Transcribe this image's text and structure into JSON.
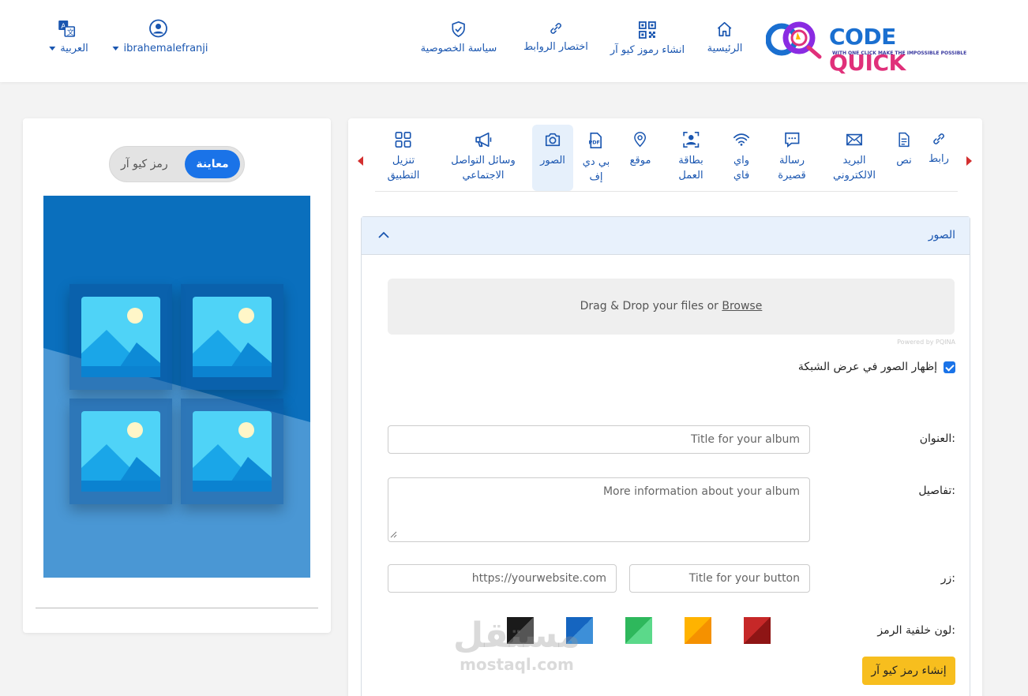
{
  "header": {
    "logo": {
      "word1": "CODE",
      "word2": "QUICK",
      "tagline": "WITH ONE CLICK MAKE THE IMPOSSIBLE POSSIBLE"
    },
    "nav": [
      {
        "label": "الرئيسية",
        "icon": "home-icon"
      },
      {
        "label": "انشاء رموز كيو آر",
        "icon": "qr-code-icon"
      },
      {
        "label": "اختصار الروابط",
        "icon": "link-icon"
      },
      {
        "label": "سياسة الخصوصية",
        "icon": "shield-check-icon"
      }
    ],
    "user": {
      "name": "ibrahemalefranji",
      "icon": "user-circle-icon"
    },
    "language": {
      "label": "العربية",
      "icon": "translate-icon"
    }
  },
  "preview": {
    "toggle_on": "معاينة",
    "toggle_off": "رمز كيو آر"
  },
  "tabs": [
    {
      "label": "رابط",
      "icon": "link-icon"
    },
    {
      "label": "نص",
      "icon": "document-text-icon"
    },
    {
      "label": "البريد\nالالكتروني",
      "icon": "envelope-icon"
    },
    {
      "label": "رسالة\nقصيرة",
      "icon": "sms-icon"
    },
    {
      "label": "واي\nفاي",
      "icon": "wifi-icon"
    },
    {
      "label": "بطاقة\nالعمل",
      "icon": "business-card-icon"
    },
    {
      "label": "موقع",
      "icon": "location-pin-icon"
    },
    {
      "label": "بي دي\nإف",
      "icon": "pdf-icon"
    },
    {
      "label": "الصور",
      "icon": "camera-icon"
    },
    {
      "label": "وسائل التواصل\nالاجتماعي",
      "icon": "megaphone-icon"
    },
    {
      "label": "تنزيل\nالتطبيق",
      "icon": "apps-grid-icon"
    }
  ],
  "form": {
    "section_title": "الصور",
    "dropzone_text": "Drag & Drop your files or ",
    "dropzone_link": "Browse",
    "powered_by": "Powered by PQINA",
    "grid_checkbox_label": "إظهار الصور في عرض الشبكة",
    "grid_checked": true,
    "title_label": "العنوان:",
    "title_placeholder": "Title for your album",
    "details_label": "تفاصيل:",
    "details_placeholder": "More information about your album",
    "button_label": "زر:",
    "button_title_placeholder": "Title for your button",
    "button_url_placeholder": "https://yourwebsite.com",
    "bg_color_label": "لون خلفية الرمز:",
    "swatches": [
      "#a51d1d",
      "#ffaa00",
      "#3cc96e",
      "#2477c4",
      "#222222"
    ],
    "submit_label": "إنشاء رمز كيو آر"
  },
  "watermark": {
    "arabic": "مستقل",
    "latin": "mostaql.com"
  }
}
